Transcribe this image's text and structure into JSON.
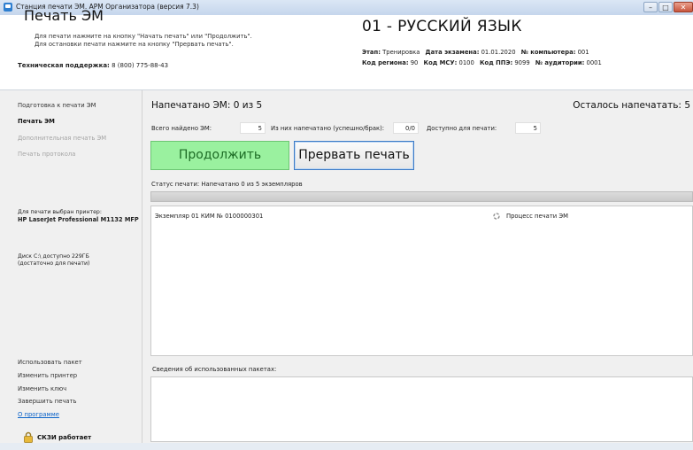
{
  "window": {
    "title": "Станция печати ЭМ. АРМ Организатора (версия 7.3)",
    "controls": {
      "minimize": "–",
      "maximize": "□",
      "close": "✕"
    }
  },
  "header": {
    "title": "Печать ЭМ",
    "hint_line1": "Для печати нажмите на кнопку \"Начать печать\" или \"Продолжить\".",
    "hint_line2": "Для остановки печати нажмите на кнопку \"Прервать печать\".",
    "support_label": "Техническая поддержка:",
    "support_phone": "8 (800) 775-88-43",
    "subject": "01 - РУССКИЙ ЯЗЫК",
    "stage_label": "Этап:",
    "stage_value": "Тренировка",
    "exam_date_label": "Дата экзамена:",
    "exam_date_value": "01.01.2020",
    "computer_label": "№ компьютера:",
    "computer_value": "001",
    "region_label": "Код региона:",
    "region_value": "90",
    "msu_label": "Код МСУ:",
    "msu_value": "0100",
    "ppe_label": "Код ППЭ:",
    "ppe_value": "9099",
    "auditorium_label": "№ аудитории:",
    "auditorium_value": "0001"
  },
  "sidebar": {
    "items": [
      {
        "label": "Подготовка к печати ЭМ",
        "state": "normal"
      },
      {
        "label": "Печать ЭМ",
        "state": "active"
      },
      {
        "label": "Дополнительная печать ЭМ",
        "state": "disabled"
      },
      {
        "label": "Печать протокола",
        "state": "disabled"
      }
    ],
    "printer_label": "Для печати выбран принтер:",
    "printer_name": "HP LaserJet Professional M1132 MFP",
    "disk_line1": "Диск C:\\ доступно 229ГБ",
    "disk_line2": "(достаточно для печати)",
    "actions": [
      {
        "label": "Использовать пакет"
      },
      {
        "label": "Изменить принтер"
      },
      {
        "label": "Изменить ключ"
      },
      {
        "label": "Завершить печать"
      },
      {
        "label": "О программе"
      }
    ],
    "skzi_status": "СКЗИ работает"
  },
  "main": {
    "printed_label": "Напечатано ЭМ:",
    "printed_count": "0",
    "printed_of": "из",
    "printed_total": "5",
    "remaining_label": "Осталось напечатать:",
    "remaining_value": "5",
    "found_label": "Всего найдено ЭМ:",
    "found_value": "5",
    "printed_ok_label": "Из них напечатано (успешно/брак):",
    "printed_ok_value": "0/0",
    "available_label": "Доступно для печати:",
    "available_value": "5",
    "continue_button": "Продолжить",
    "stop_button": "Прервать печать",
    "status_label": "Статус печати:",
    "status_value": "Напечатано 0 из 5 экземпляров",
    "progress_fraction": 0,
    "copy_row": "Экземпляр 01  КИМ № 0100000301",
    "process_status": "Процесс печати ЭМ",
    "packages_label": "Сведения об использованных пакетах:"
  },
  "colors": {
    "continue_bg": "#9af19f",
    "link": "#0b63c9",
    "disabled_text": "#a4a4a4"
  }
}
